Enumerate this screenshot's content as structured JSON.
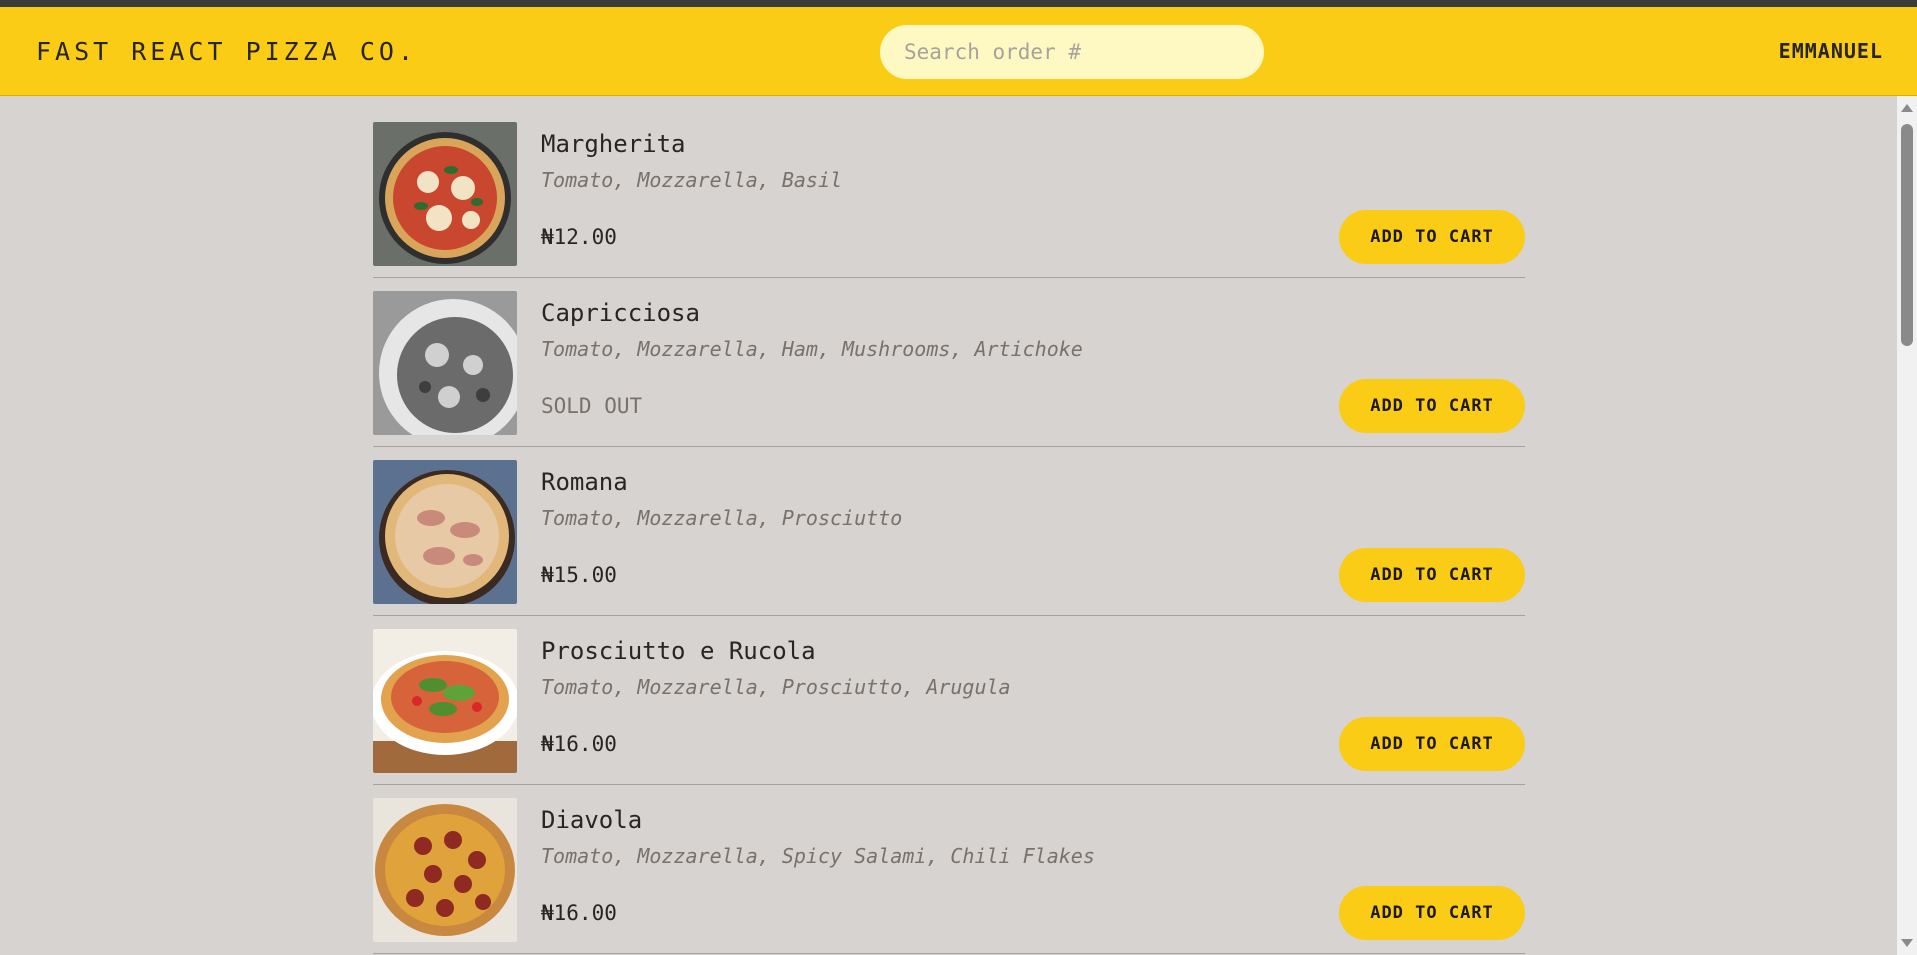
{
  "header": {
    "logo": "Fast React Pizza Co.",
    "search_placeholder": "Search order #",
    "username": "Emmanuel"
  },
  "menu": {
    "items": [
      {
        "name": "Margherita",
        "ingredients": "Tomato, Mozzarella, Basil",
        "price": "₦12.00",
        "sold_out": false,
        "button": "Add to cart"
      },
      {
        "name": "Capricciosa",
        "ingredients": "Tomato, Mozzarella, Ham, Mushrooms, Artichoke",
        "status": "Sold out",
        "sold_out": true,
        "button": "Add to cart"
      },
      {
        "name": "Romana",
        "ingredients": "Tomato, Mozzarella, Prosciutto",
        "price": "₦15.00",
        "sold_out": false,
        "button": "Add to cart"
      },
      {
        "name": "Prosciutto e Rucola",
        "ingredients": "Tomato, Mozzarella, Prosciutto, Arugula",
        "price": "₦16.00",
        "sold_out": false,
        "button": "Add to cart"
      },
      {
        "name": "Diavola",
        "ingredients": "Tomato, Mozzarella, Spicy Salami, Chili Flakes",
        "price": "₦16.00",
        "sold_out": false,
        "button": "Add to cart"
      }
    ]
  },
  "colors": {
    "accent": "#facc15",
    "search_bg": "#fef9c3",
    "page_bg": "#d6d3d1",
    "muted_text": "#78716c"
  }
}
